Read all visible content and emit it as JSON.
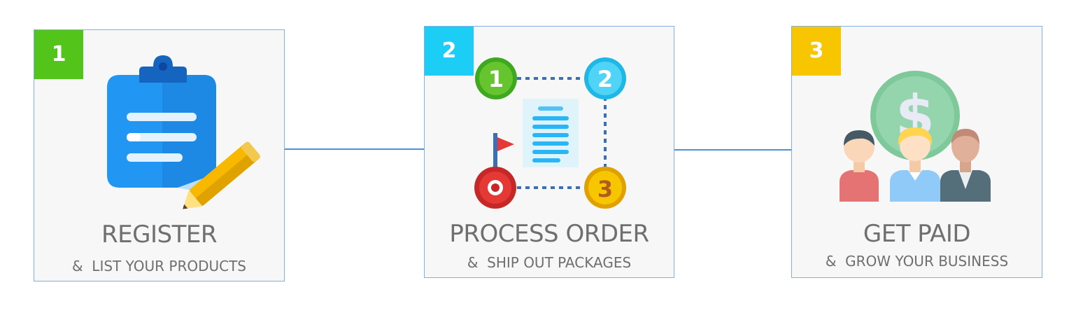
{
  "colors": {
    "line": "#4a90d9",
    "badge_1": "#52c41a",
    "badge_2": "#1ccef5",
    "badge_3": "#f7c600",
    "text": "#6f6f6f"
  },
  "steps": [
    {
      "number": "1",
      "title": "REGISTER",
      "subtitle": "&  LIST YOUR PRODUCTS",
      "icon": "clipboard-pencil-icon"
    },
    {
      "number": "2",
      "title": "PROCESS ORDER",
      "subtitle": "&  SHIP OUT PACKAGES",
      "icon": "order-route-icon",
      "route_labels": [
        "1",
        "2",
        "3"
      ]
    },
    {
      "number": "3",
      "title": "GET PAID",
      "subtitle": "&  GROW YOUR BUSINESS",
      "icon": "people-money-icon"
    }
  ]
}
